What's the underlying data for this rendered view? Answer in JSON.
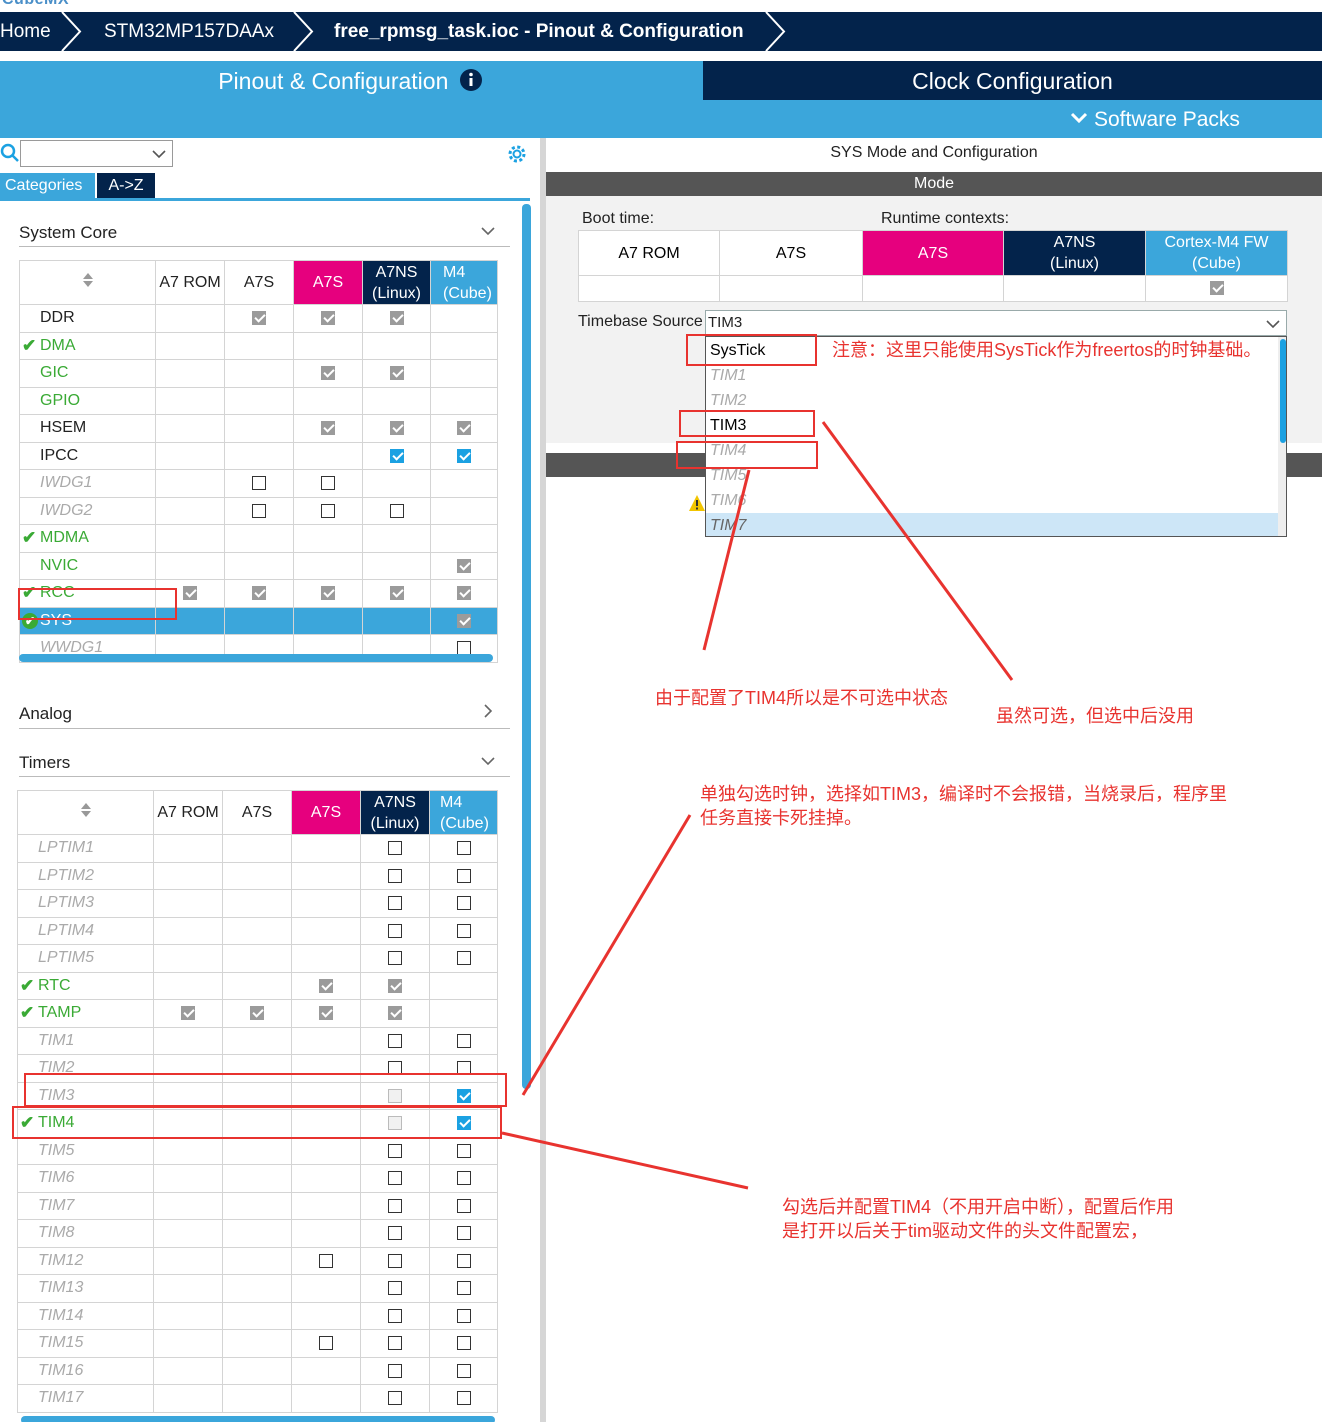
{
  "logo_text": "CubeMX",
  "breadcrumb": [
    "Home",
    "STM32MP157DAAx",
    "free_rpmsg_task.ioc - Pinout & Configuration"
  ],
  "tabs": {
    "pinout": "Pinout & Configuration",
    "clock": "Clock Configuration",
    "software_packs": "Software Packs"
  },
  "left": {
    "category_tab": "Categories",
    "az_tab": "A->Z",
    "sections": {
      "system_core": "System Core",
      "analog": "Analog",
      "timers": "Timers"
    },
    "columns": [
      "A7 ROM",
      "A7S",
      "A7S",
      "A7NS",
      "(Linux)",
      "M4",
      "(Cube)"
    ],
    "system_core_rows": [
      {
        "name": "DDR",
        "style": "normal",
        "ok": false,
        "cells": [
          "",
          "g",
          "g",
          "g",
          ""
        ]
      },
      {
        "name": "DMA",
        "style": "green",
        "ok": true,
        "cells": [
          "",
          "",
          "",
          "",
          ""
        ]
      },
      {
        "name": "GIC",
        "style": "green",
        "ok": false,
        "cells": [
          "",
          "",
          "g",
          "g",
          ""
        ]
      },
      {
        "name": "GPIO",
        "style": "green",
        "ok": false,
        "cells": [
          "",
          "",
          "",
          "",
          ""
        ]
      },
      {
        "name": "HSEM",
        "style": "normal",
        "ok": false,
        "cells": [
          "",
          "",
          "g",
          "g",
          "g"
        ]
      },
      {
        "name": "IPCC",
        "style": "normal",
        "ok": false,
        "cells": [
          "",
          "",
          "",
          "b",
          "b"
        ]
      },
      {
        "name": "IWDG1",
        "style": "dis",
        "ok": false,
        "cells": [
          "",
          "u",
          "u",
          "",
          ""
        ]
      },
      {
        "name": "IWDG2",
        "style": "dis",
        "ok": false,
        "cells": [
          "",
          "u",
          "u",
          "u",
          ""
        ]
      },
      {
        "name": "MDMA",
        "style": "green",
        "ok": true,
        "cells": [
          "",
          "",
          "",
          "",
          ""
        ]
      },
      {
        "name": "NVIC",
        "style": "green",
        "ok": false,
        "cells": [
          "",
          "",
          "",
          "",
          "g"
        ]
      },
      {
        "name": "RCC",
        "style": "green",
        "ok": true,
        "cells": [
          "g",
          "g",
          "g",
          "g",
          "g"
        ]
      },
      {
        "name": "SYS",
        "style": "selected",
        "ok": true,
        "cells": [
          "",
          "",
          "",
          "",
          "g"
        ]
      },
      {
        "name": "WWDG1",
        "style": "dis",
        "ok": false,
        "cells": [
          "",
          "",
          "",
          "",
          "u"
        ]
      }
    ],
    "timers_rows": [
      {
        "name": "LPTIM1",
        "style": "dis",
        "ok": false,
        "cells": [
          "",
          "",
          "",
          "u",
          "u"
        ]
      },
      {
        "name": "LPTIM2",
        "style": "dis",
        "ok": false,
        "cells": [
          "",
          "",
          "",
          "u",
          "u"
        ]
      },
      {
        "name": "LPTIM3",
        "style": "dis",
        "ok": false,
        "cells": [
          "",
          "",
          "",
          "u",
          "u"
        ]
      },
      {
        "name": "LPTIM4",
        "style": "dis",
        "ok": false,
        "cells": [
          "",
          "",
          "",
          "u",
          "u"
        ]
      },
      {
        "name": "LPTIM5",
        "style": "dis",
        "ok": false,
        "cells": [
          "",
          "",
          "",
          "u",
          "u"
        ]
      },
      {
        "name": "RTC",
        "style": "green",
        "ok": true,
        "cells": [
          "",
          "",
          "g",
          "g",
          ""
        ]
      },
      {
        "name": "TAMP",
        "style": "green",
        "ok": true,
        "cells": [
          "g",
          "g",
          "g",
          "g",
          ""
        ]
      },
      {
        "name": "TIM1",
        "style": "dis",
        "ok": false,
        "cells": [
          "",
          "",
          "",
          "u",
          "u"
        ]
      },
      {
        "name": "TIM2",
        "style": "dis",
        "ok": false,
        "cells": [
          "",
          "",
          "",
          "u",
          "u"
        ]
      },
      {
        "name": "TIM3",
        "style": "dis",
        "ok": false,
        "cells": [
          "",
          "",
          "",
          "d",
          "b"
        ]
      },
      {
        "name": "TIM4",
        "style": "green",
        "ok": true,
        "cells": [
          "",
          "",
          "",
          "d",
          "b"
        ]
      },
      {
        "name": "TIM5",
        "style": "dis",
        "ok": false,
        "cells": [
          "",
          "",
          "",
          "u",
          "u"
        ]
      },
      {
        "name": "TIM6",
        "style": "dis",
        "ok": false,
        "cells": [
          "",
          "",
          "",
          "u",
          "u"
        ]
      },
      {
        "name": "TIM7",
        "style": "dis",
        "ok": false,
        "cells": [
          "",
          "",
          "",
          "u",
          "u"
        ]
      },
      {
        "name": "TIM8",
        "style": "dis",
        "ok": false,
        "cells": [
          "",
          "",
          "",
          "u",
          "u"
        ]
      },
      {
        "name": "TIM12",
        "style": "dis",
        "ok": false,
        "cells": [
          "",
          "",
          "u",
          "u",
          "u"
        ]
      },
      {
        "name": "TIM13",
        "style": "dis",
        "ok": false,
        "cells": [
          "",
          "",
          "",
          "u",
          "u"
        ]
      },
      {
        "name": "TIM14",
        "style": "dis",
        "ok": false,
        "cells": [
          "",
          "",
          "",
          "u",
          "u"
        ]
      },
      {
        "name": "TIM15",
        "style": "dis",
        "ok": false,
        "cells": [
          "",
          "",
          "u",
          "u",
          "u"
        ]
      },
      {
        "name": "TIM16",
        "style": "dis",
        "ok": false,
        "cells": [
          "",
          "",
          "",
          "u",
          "u"
        ]
      },
      {
        "name": "TIM17",
        "style": "dis",
        "ok": false,
        "cells": [
          "",
          "",
          "",
          "u",
          "u"
        ]
      }
    ]
  },
  "right": {
    "title": "SYS Mode and Configuration",
    "mode_bar": "Mode",
    "boot_time": "Boot time:",
    "runtime_contexts": "Runtime contexts:",
    "ctx_headers": [
      "A7 ROM",
      "A7S",
      "A7S",
      "A7NS",
      "(Linux)",
      "Cortex-M4 FW",
      "(Cube)"
    ],
    "timebase_label": "Timebase Source",
    "timebase_value": "TIM3",
    "dropdown_options": [
      {
        "label": "SysTick",
        "enabled": true
      },
      {
        "label": "TIM1",
        "enabled": false
      },
      {
        "label": "TIM2",
        "enabled": false
      },
      {
        "label": "TIM3",
        "enabled": true
      },
      {
        "label": "TIM4",
        "enabled": false
      },
      {
        "label": "TIM5",
        "enabled": false
      },
      {
        "label": "TIM6",
        "enabled": false
      },
      {
        "label": "TIM7",
        "enabled": false
      }
    ]
  },
  "annotations": {
    "note_systick": "注意：这里只能使用SysTick作为freertos的时钟基础。",
    "note_tim4": "由于配置了TIM4所以是不可选中状态",
    "note_tim3_selectable": "虽然可选，但选中后没用",
    "note_single_line1": "单独勾选时钟，选择如TIM3，编译时不会报错，当烧录后，程序里",
    "note_single_line2": "任务直接卡死挂掉。",
    "note_config_line1": "勾选后并配置TIM4（不用开启中断），配置后作用",
    "note_config_line2": "是打开以后关于tim驱动文件的头文件配置宏，"
  },
  "colors": {
    "navy": "#03234b",
    "blue": "#3ba6db",
    "pink": "#e6007e",
    "green": "#3aaa35",
    "red": "#e8332f"
  }
}
